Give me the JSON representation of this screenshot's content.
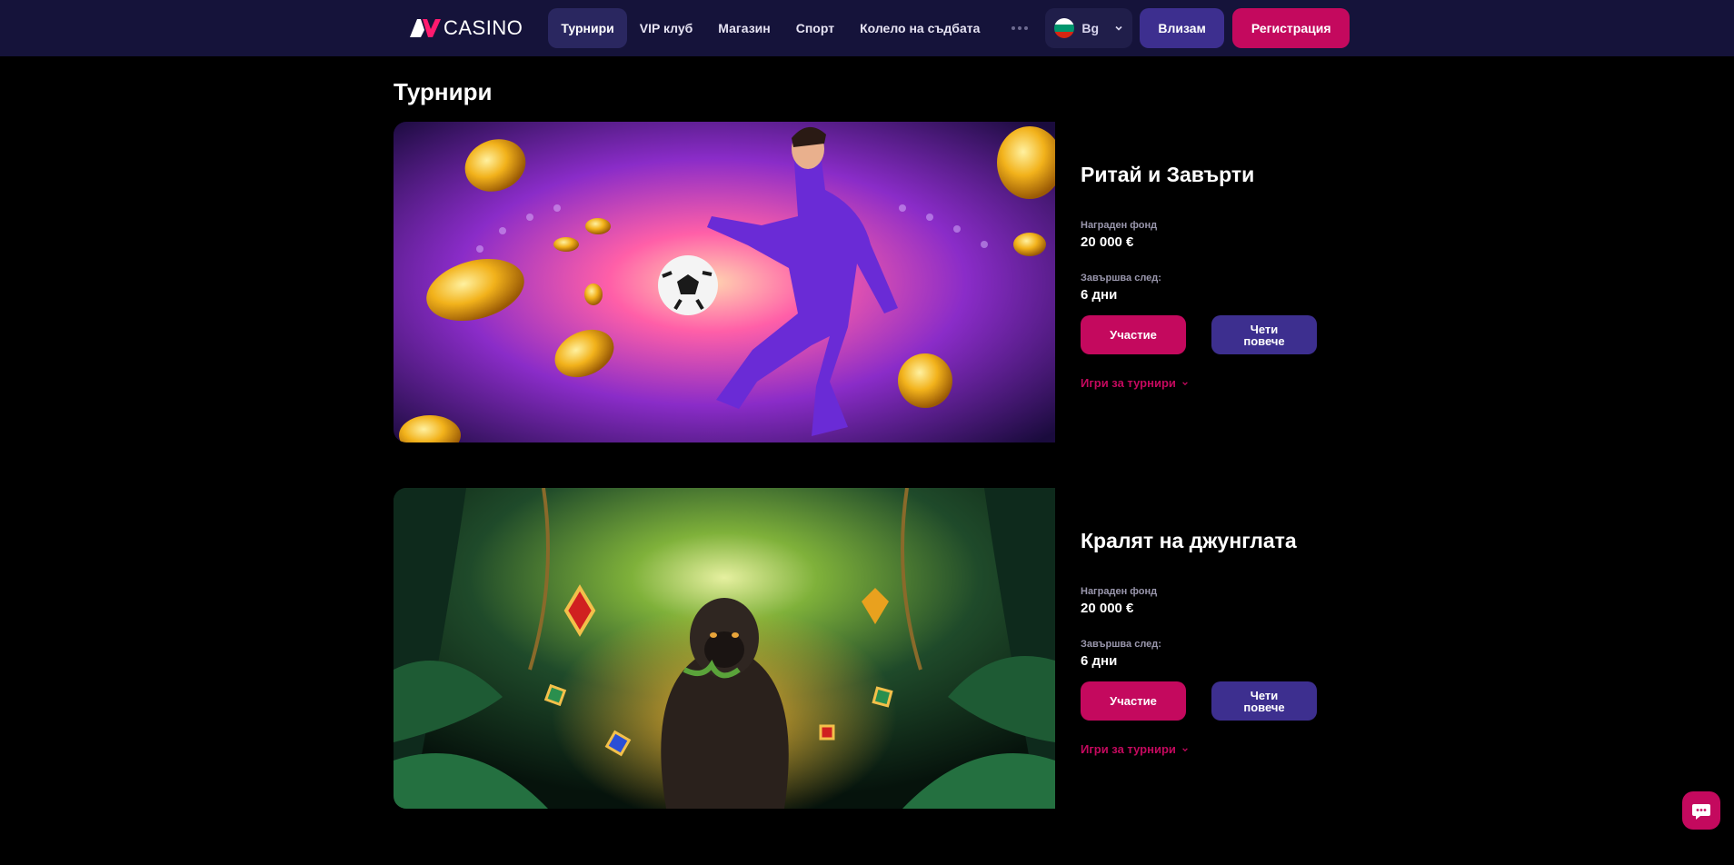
{
  "header": {
    "logo_text": "CASINO",
    "nav": [
      {
        "label": "Турнири",
        "active": true
      },
      {
        "label": "VIP клуб",
        "active": false
      },
      {
        "label": "Магазин",
        "active": false
      },
      {
        "label": "Спорт",
        "active": false
      },
      {
        "label": "Колело на съдбата",
        "active": false
      }
    ],
    "more_icon": "more-dots-icon",
    "language": {
      "label": "Bg",
      "flag": "bulgaria-flag-icon"
    },
    "login_label": "Влизам",
    "register_label": "Регистрация"
  },
  "page_title": "Турнири",
  "tournaments": [
    {
      "name": "Ритай и Завърти",
      "image": "soccer-player-coins-banner",
      "prize_label": "Награден фонд",
      "prize_value": "20 000 €",
      "ends_label": "Завършва след:",
      "ends_value": "6 дни",
      "join_label": "Участие",
      "read_more_label": "Чети повече",
      "games_link": "Игри за турнири"
    },
    {
      "name": "Кралят на джунглата",
      "image": "jungle-gorilla-banner",
      "prize_label": "Награден фонд",
      "prize_value": "20 000 €",
      "ends_label": "Завършва след:",
      "ends_value": "6 дни",
      "join_label": "Участие",
      "read_more_label": "Чети повече",
      "games_link": "Игри за турнири"
    }
  ],
  "chat_icon": "chat-bubble-icon",
  "colors": {
    "accent": "#c4095e",
    "secondary": "#3d2f8f",
    "header_bg": "#15133a",
    "page_bg": "#000000"
  }
}
